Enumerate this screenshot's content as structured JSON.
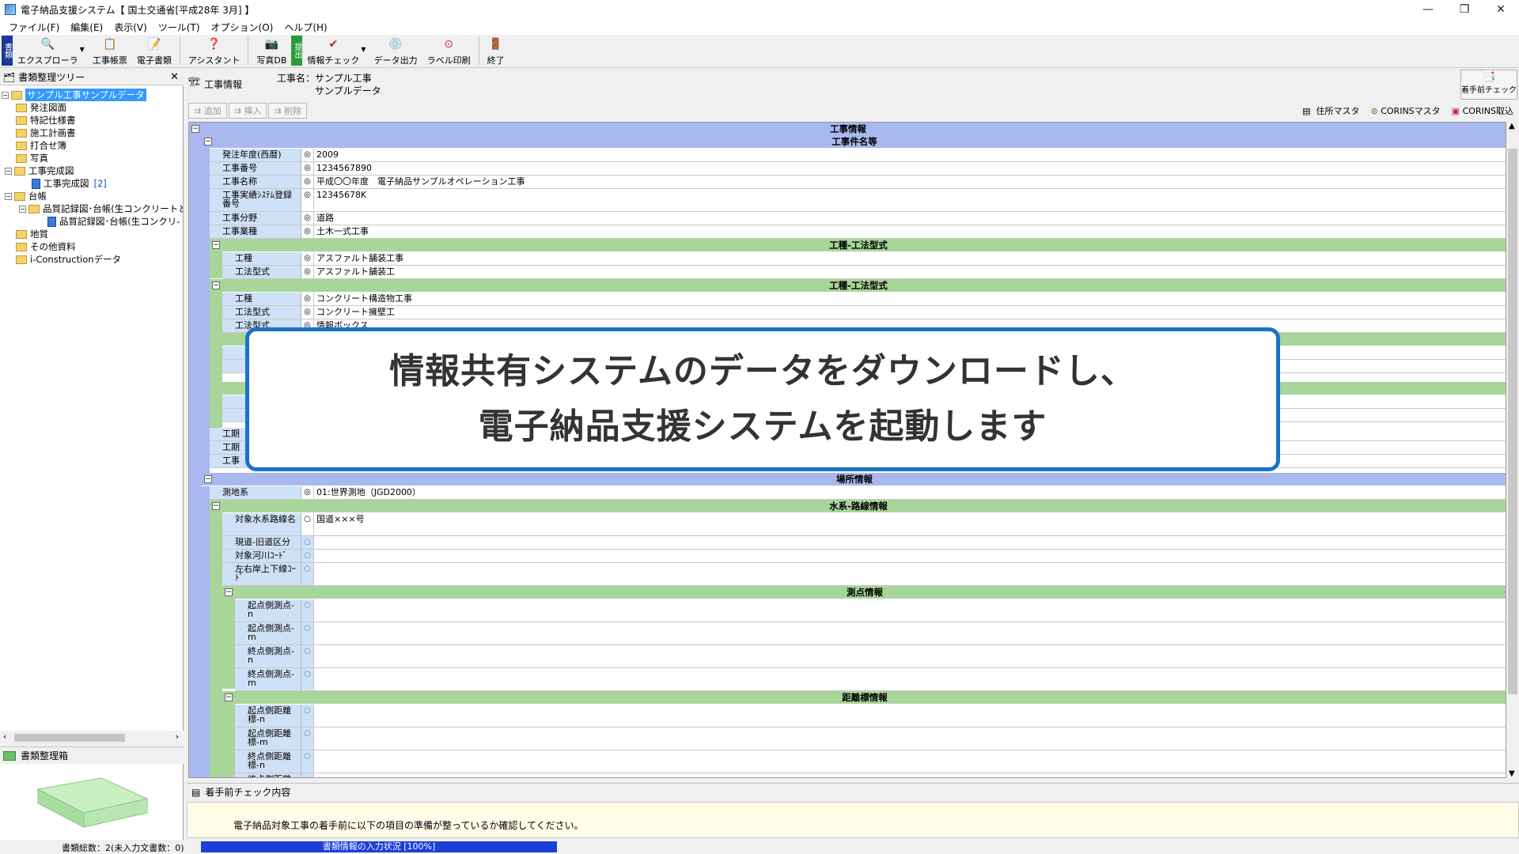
{
  "window": {
    "title": "電子納品支援システム【 国土交通省[平成28年 3月] 】",
    "buttons": [
      "—",
      "❐",
      "✕"
    ]
  },
  "menu": [
    "ファイル(F)",
    "編集(E)",
    "表示(V)",
    "ツール(T)",
    "オプション(O)",
    "ヘルプ(H)"
  ],
  "toolbar": {
    "tab_shorui": "書類",
    "tab_teishutsu": "提出",
    "explorer": "エクスプローラ",
    "koji_chohyo": "工事帳票",
    "denshi_shorui": "電子書類",
    "assistant": "アシスタント",
    "photo_db": "写真DB",
    "info_check": "情報チェック",
    "data_output": "データ出力",
    "label_print": "ラベル印刷",
    "exit": "終了"
  },
  "tree": {
    "header": "書類整理ツリー",
    "items": [
      "サンプル工事サンプルデータ",
      "発注図面",
      "特記仕様書",
      "施工計画書",
      "打合せ簿",
      "写真",
      "工事完成図",
      "工事完成図",
      "[2]",
      "台帳",
      "品質記録図･台帳(生コンクリートと",
      "品質記録図･台帳(生コンクリ-",
      "地質",
      "その他資料",
      "i-Constructionデータ"
    ],
    "footer": "書類整理箱"
  },
  "content": {
    "tab_label": "工事情報",
    "koji_name_label": "工事名：サンプル工事",
    "koji_name_line2": "サンプルデータ",
    "pre_check_button": "着手前チェック",
    "sub_add": "追加",
    "sub_insert": "挿入",
    "sub_delete": "削除",
    "address_master": "住所マスタ",
    "corins_master": "CORINSマスタ",
    "corins_import": "CORINS取込"
  },
  "form": {
    "band_koji_info": "工事情報",
    "band_koji_kenmei": "工事件名等",
    "rows1": [
      {
        "label": "発注年度(西暦)",
        "mark": "◎",
        "value": "2009"
      },
      {
        "label": "工事番号",
        "mark": "◎",
        "value": "1234567890"
      },
      {
        "label": "工事名称",
        "mark": "◎",
        "value": "平成〇〇年度　電子納品サンプルオペレーション工事"
      },
      {
        "label": "工事実績ｼｽﾃﾑ登録番号",
        "mark": "◎",
        "value": "12345678K"
      },
      {
        "label": "工事分野",
        "mark": "◎",
        "value": "道路"
      },
      {
        "label": "工事業種",
        "mark": "◎",
        "value": "土木一式工事"
      }
    ],
    "band_kosyu1": "工種-工法型式",
    "rows2": [
      {
        "label": "工種",
        "mark": "◎",
        "value": "アスファルト舗装工事"
      },
      {
        "label": "工法型式",
        "mark": "◎",
        "value": "アスファルト舗装工"
      }
    ],
    "band_kosyu2": "工種-工法型式",
    "rows3": [
      {
        "label": "工種",
        "mark": "◎",
        "value": "コンクリート構造物工事"
      },
      {
        "label": "工法型式",
        "mark": "◎",
        "value": "コンクリート擁壁工"
      },
      {
        "label": "工法型式",
        "mark": "◎",
        "value": "情報ボックス"
      }
    ],
    "rows_hidden_prefix": [
      "工期",
      "工期",
      "工事"
    ],
    "band_basho": "場所情報",
    "rows4": [
      {
        "label": "測地系",
        "mark": "◎",
        "value": "01:世界測地（JGD2000）"
      }
    ],
    "band_suikei": "水系-路線情報",
    "rows5": [
      {
        "label": "対象水系路線名",
        "mark": "○",
        "value": "国道×××号"
      },
      {
        "label": "現道-旧道区分",
        "mark": "",
        "value": ""
      },
      {
        "label": "対象河川ｺｰﾄﾞ",
        "mark": "",
        "value": ""
      },
      {
        "label": "左右岸上下線ｺｰﾄﾞ",
        "mark": "",
        "value": ""
      }
    ],
    "band_sokuten": "測点情報",
    "rows6": [
      {
        "label": "起点側測点-n",
        "mark": "",
        "value": ""
      },
      {
        "label": "起点側測点-m",
        "mark": "",
        "value": ""
      },
      {
        "label": "終点側測点-n",
        "mark": "",
        "value": ""
      },
      {
        "label": "終点側測点-m",
        "mark": "",
        "value": ""
      }
    ],
    "band_kyori": "距離標情報",
    "rows7": [
      {
        "label": "起点側距離標-n",
        "mark": "",
        "value": ""
      },
      {
        "label": "起点側距離標-m",
        "mark": "",
        "value": ""
      },
      {
        "label": "終点側距離標-n",
        "mark": "",
        "value": ""
      },
      {
        "label": "終点側距離標-m",
        "mark": "",
        "value": ""
      }
    ]
  },
  "check": {
    "header": "着手前チェック内容",
    "message": "電子納品対象工事の着手前に以下の項目の準備が整っているか確認してください。"
  },
  "status": {
    "count": "書類総数：2(未入力文書数：0)",
    "progress_label": "書類情報の入力状況 [100%]",
    "progress": 1.0
  },
  "overlay": {
    "line1": "情報共有システムのデータをダウンロードし、",
    "line2": "電子納品支援システムを起動します"
  },
  "colors": {
    "band_blue": "#a9b8ee",
    "band_green": "#a8d59a",
    "overlay_border": "#1b72c9",
    "progress": "#1c3fd8"
  }
}
